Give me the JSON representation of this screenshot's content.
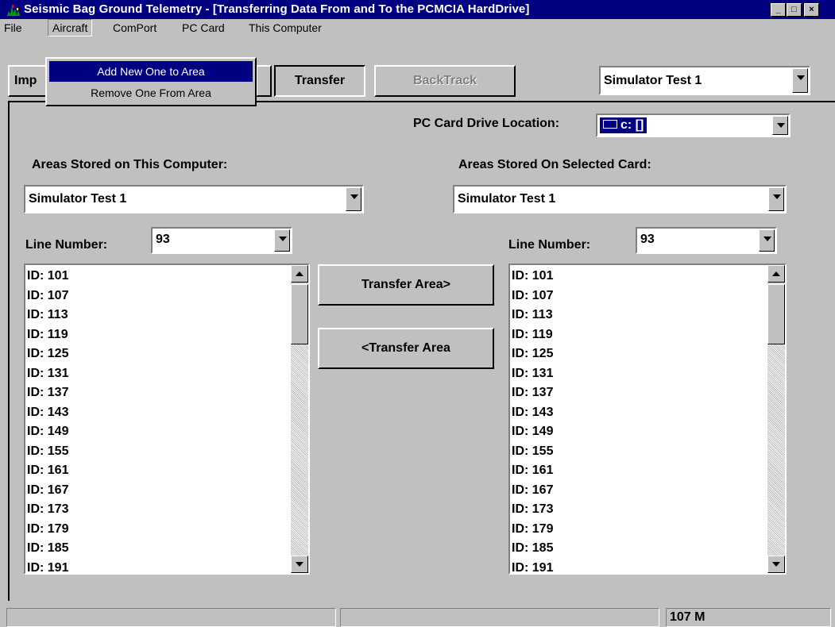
{
  "window": {
    "title": "Seismic Bag Ground Telemetry - [Transferring Data From and To the PCMCIA HardDrive]",
    "minimize": "_",
    "maximize": "□",
    "close": "×"
  },
  "menu": {
    "file": "File",
    "aircraft": "Aircraft",
    "comport": "ComPort",
    "pccard": "PC Card",
    "thiscomputer": "This Computer"
  },
  "aircraft_menu": {
    "items": [
      "Add New One to Area",
      "Remove One From Area"
    ],
    "highlighted": "Add New One to Area"
  },
  "toolbar": {
    "import_label": "Imp",
    "transfer_label": "Transfer",
    "backtrack_label": "BackTrack",
    "area_select": "Simulator Test 1"
  },
  "drive": {
    "label": "PC Card Drive Location:",
    "value": "c: []"
  },
  "left": {
    "areas_label": "Areas Stored on This Computer:",
    "area_value": "Simulator Test 1",
    "line_label": "Line Number:",
    "line_value": "93",
    "ids": [
      "ID: 101",
      "ID: 107",
      "ID: 113",
      "ID: 119",
      "ID: 125",
      "ID: 131",
      "ID: 137",
      "ID: 143",
      "ID: 149",
      "ID: 155",
      "ID: 161",
      "ID: 167",
      "ID: 173",
      "ID: 179",
      "ID: 185",
      "ID: 191"
    ]
  },
  "right": {
    "areas_label": "Areas Stored On Selected Card:",
    "area_value": "Simulator Test 1",
    "line_label": "Line Number:",
    "line_value": "93",
    "ids": [
      "ID: 101",
      "ID: 107",
      "ID: 113",
      "ID: 119",
      "ID: 125",
      "ID: 131",
      "ID: 137",
      "ID: 143",
      "ID: 149",
      "ID: 155",
      "ID: 161",
      "ID: 167",
      "ID: 173",
      "ID: 179",
      "ID: 185",
      "ID: 191"
    ]
  },
  "actions": {
    "transfer_right": "Transfer Area>",
    "transfer_left": "<Transfer Area"
  },
  "status": {
    "cell1": "",
    "cell2": "",
    "disk": "107 M"
  }
}
